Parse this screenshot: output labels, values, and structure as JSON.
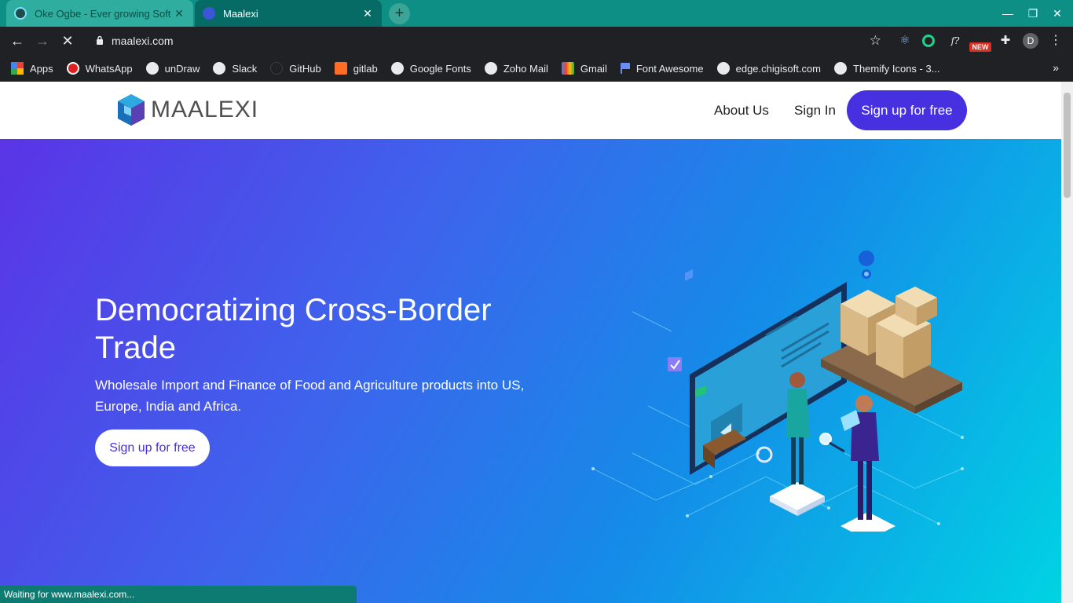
{
  "browser": {
    "tabs": [
      {
        "title": "Oke Ogbe - Ever growing Soft",
        "active": false
      },
      {
        "title": "Maalexi",
        "active": true
      }
    ],
    "new_tab": "+",
    "window_controls": {
      "minimize": "—",
      "restore": "❐",
      "close": "✕"
    },
    "url": "maalexi.com",
    "extensions": {
      "new_badge": "NEW",
      "avatar": "D"
    },
    "bookmarks": [
      {
        "label": "Apps",
        "icon": "apps-grid-icon"
      },
      {
        "label": "WhatsApp",
        "icon": "whatsapp-icon"
      },
      {
        "label": "unDraw",
        "icon": "globe-icon"
      },
      {
        "label": "Slack",
        "icon": "globe-icon"
      },
      {
        "label": "GitHub",
        "icon": "github-icon"
      },
      {
        "label": "gitlab",
        "icon": "gitlab-icon"
      },
      {
        "label": "Google Fonts",
        "icon": "globe-icon"
      },
      {
        "label": "Zoho Mail",
        "icon": "globe-icon"
      },
      {
        "label": "Gmail",
        "icon": "gmail-icon"
      },
      {
        "label": "Font Awesome",
        "icon": "flag-icon"
      },
      {
        "label": "edge.chigisoft.com",
        "icon": "globe-icon"
      },
      {
        "label": "Themify Icons - 3...",
        "icon": "globe-icon"
      }
    ],
    "status": "Waiting for www.maalexi.com..."
  },
  "site": {
    "logo": "MAALEXI",
    "nav": {
      "about": "About Us",
      "signin": "Sign In",
      "cta": "Sign up for free"
    },
    "hero": {
      "title": "Democratizing Cross-Border Trade",
      "subtitle": "Wholesale Import and Finance of Food and Agriculture products into US, Europe, India and Africa.",
      "cta": "Sign up for free"
    }
  },
  "colors": {
    "tab_bar": "#0d8f86",
    "toolbar": "#202124",
    "brand": "#4630e0",
    "hero_start": "#5a34e6",
    "hero_end": "#00d3e3"
  }
}
